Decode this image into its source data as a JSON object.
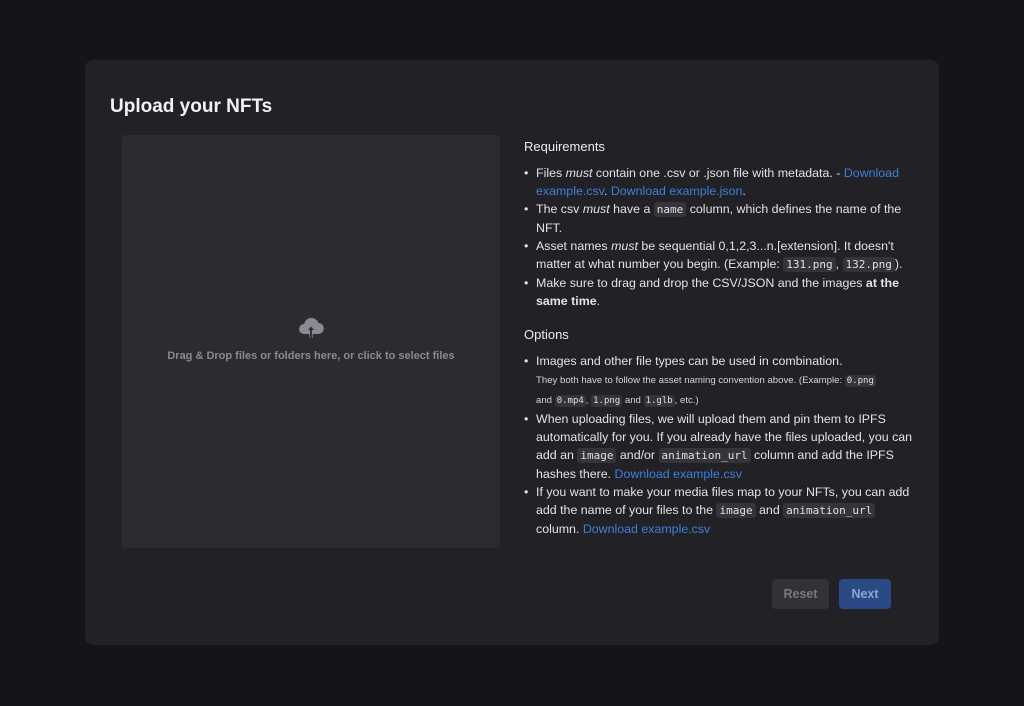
{
  "modal": {
    "title": "Upload your NFTs"
  },
  "dropzone": {
    "icon": "cloud-upload-icon",
    "text": "Drag & Drop files or folders here, or click to select files"
  },
  "requirements": {
    "title": "Requirements",
    "items": [
      {
        "t1": "Files ",
        "em": "must",
        "t2": " contain one .csv or .json file with metadata. - ",
        "link1": "Download example.csv",
        "sep": ". ",
        "link2": "Download example.json",
        "t3": "."
      },
      {
        "t1": "The csv ",
        "em": "must",
        "t2": " have a ",
        "code": "name",
        "t3": " column, which defines the name of the NFT."
      },
      {
        "t1": "Asset names ",
        "em": "must",
        "t2": " be sequential 0,1,2,3...n.[extension]. It doesn't matter at what number you begin. (Example: ",
        "code1": "131.png",
        "t3": ", ",
        "code2": "132.png",
        "t4": ")."
      },
      {
        "t1": "Make sure to drag and drop the CSV/JSON and the images ",
        "strong": "at the same time",
        "t2": "."
      }
    ]
  },
  "options": {
    "title": "Options",
    "items": [
      {
        "t1": "Images and other file types can be used in combination.",
        "s1": "They both have to follow the asset naming convention above. (Example: ",
        "c1": "0.png",
        "s2": " and ",
        "c2": "0.mp4",
        "s3": ", ",
        "c3": "1.png",
        "s4": " and ",
        "c4": "1.glb",
        "s5": ", etc.)"
      },
      {
        "t1": "When uploading files, we will upload them and pin them to IPFS automatically for you. If you already have the files uploaded, you can add an ",
        "code1": "image",
        "t2": " and/or ",
        "code2": "animation_url",
        "t3": " column and add the IPFS hashes there. ",
        "link": "Download example.csv"
      },
      {
        "t1": "If you want to make your media files map to your NFTs, you can add add the name of your files to the ",
        "code1": "image",
        "t2": " and ",
        "code2": "animation_url",
        "t3": " column. ",
        "link": "Download example.csv"
      }
    ]
  },
  "buttons": {
    "reset": "Reset",
    "next": "Next"
  },
  "colors": {
    "accent": "#3f7fdc",
    "next_button": "#2a4a85",
    "background": "#151519",
    "modal": "#222226"
  }
}
